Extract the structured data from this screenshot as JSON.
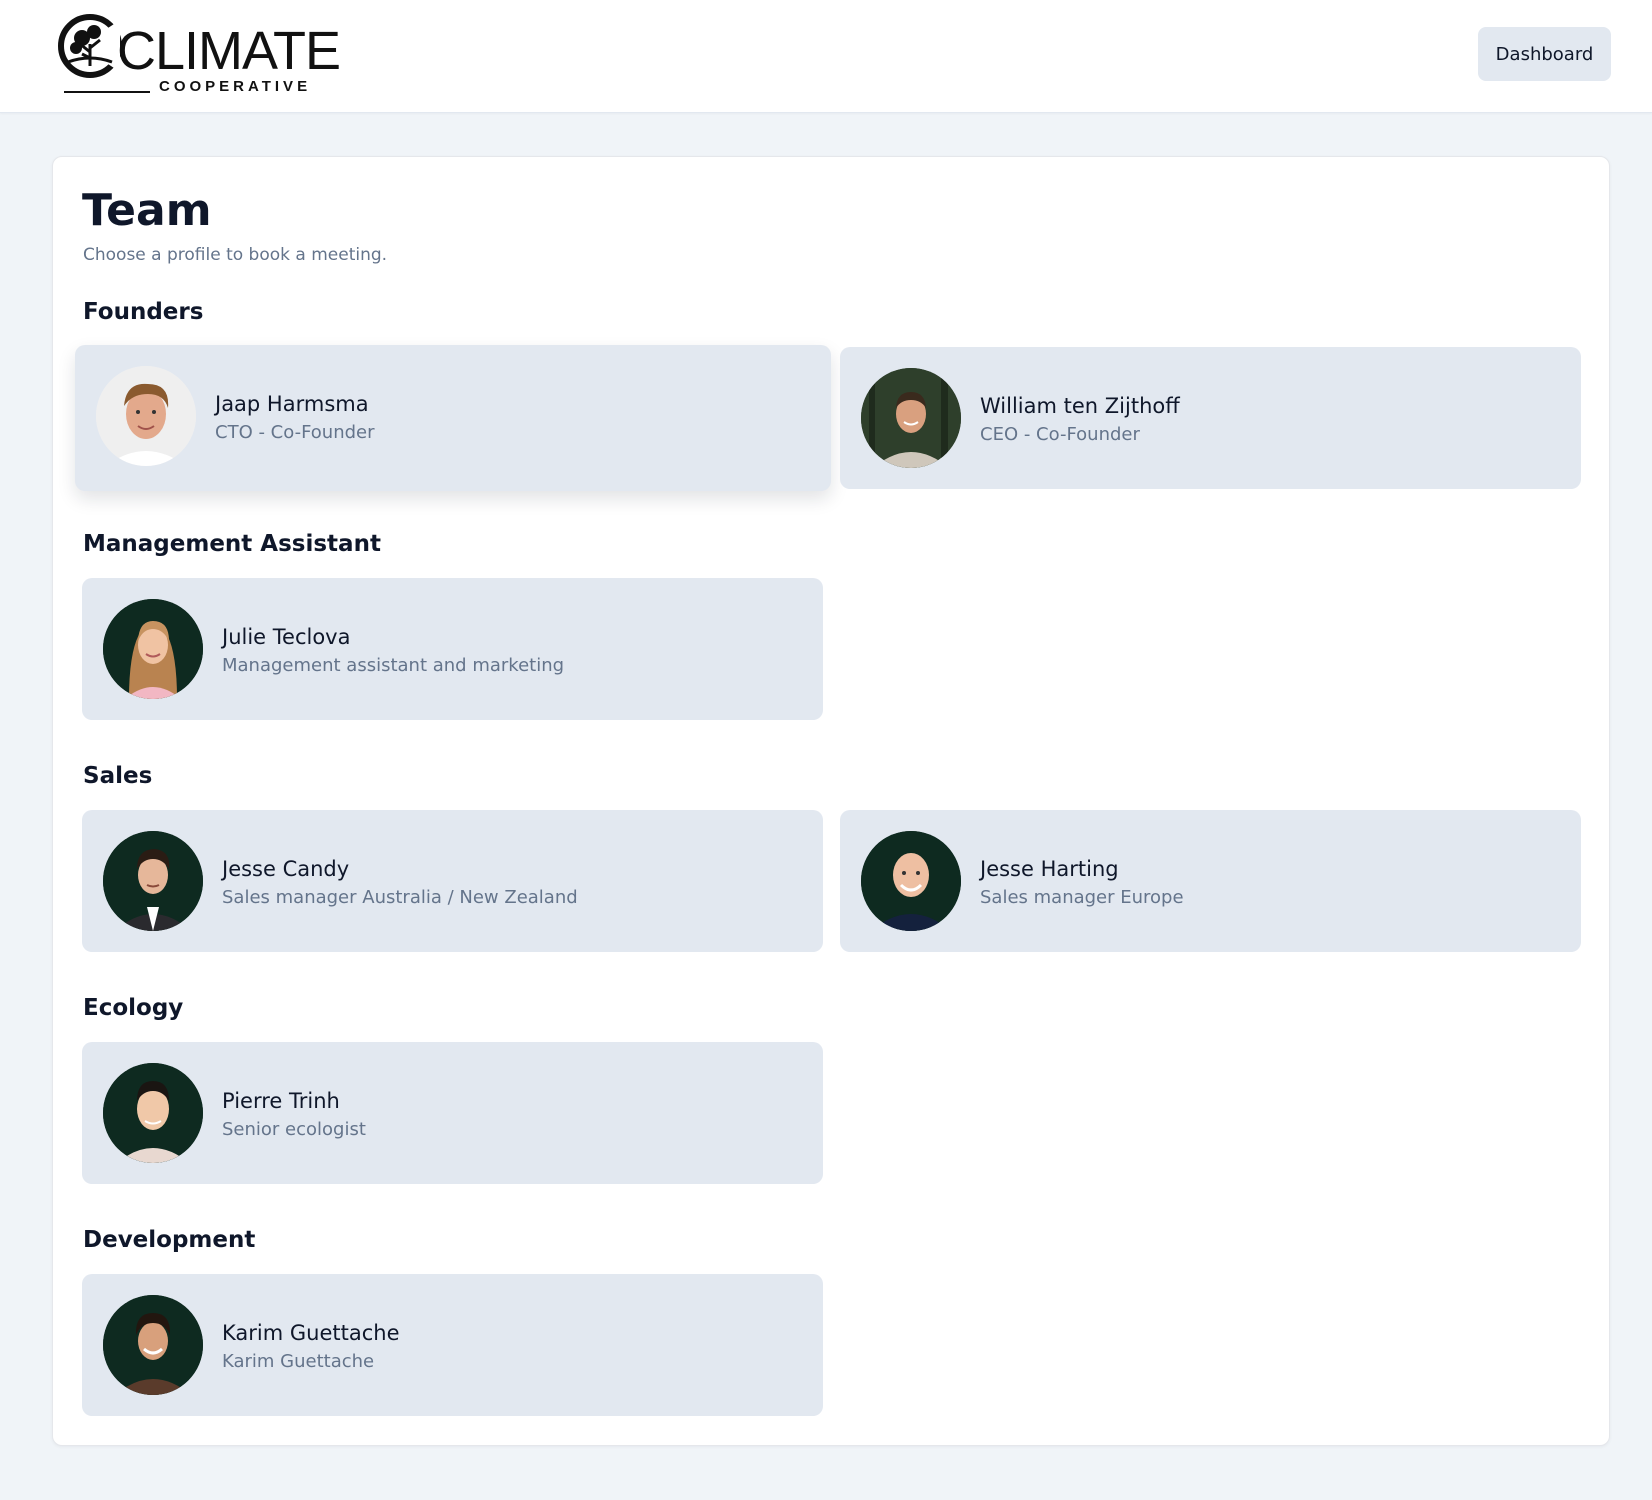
{
  "header": {
    "logo": {
      "word": "CLIMATE",
      "sub": "COOPERATIVE",
      "initial": "C"
    },
    "dashboard_label": "Dashboard"
  },
  "page": {
    "title": "Team",
    "subtitle": "Choose a profile to book a meeting."
  },
  "sections": [
    {
      "title": "Founders",
      "members": [
        {
          "name": "Jaap Harmsma",
          "role": "CTO - Co-Founder"
        },
        {
          "name": "William ten Zijthoff",
          "role": "CEO - Co-Founder"
        }
      ]
    },
    {
      "title": "Management Assistant",
      "members": [
        {
          "name": "Julie Teclova",
          "role": "Management assistant and marketing"
        }
      ]
    },
    {
      "title": "Sales",
      "members": [
        {
          "name": "Jesse Candy",
          "role": "Sales manager Australia / New Zealand"
        },
        {
          "name": "Jesse Harting",
          "role": "Sales manager Europe"
        }
      ]
    },
    {
      "title": "Ecology",
      "members": [
        {
          "name": "Pierre Trinh",
          "role": "Senior ecologist"
        }
      ]
    },
    {
      "title": "Development",
      "members": [
        {
          "name": "Karim Guettache",
          "role": "Karim Guettache"
        }
      ]
    }
  ],
  "colors": {
    "page_bg": "#f0f4f8",
    "card_bg": "#ffffff",
    "profile_bg": "#e2e8f0",
    "avatar_bg": "#0e2a20",
    "text_primary": "#0f172a",
    "text_muted": "#64748b"
  }
}
